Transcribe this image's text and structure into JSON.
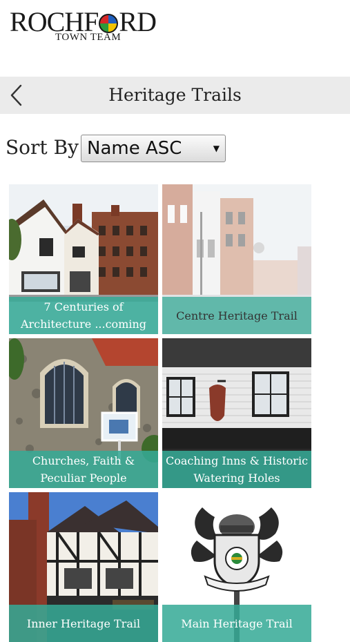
{
  "logo": {
    "main_pre": "R",
    "main_c": "OCHF",
    "main_post": "RD",
    "sub": "TOWN TEAM"
  },
  "header": {
    "title": "Heritage Trails",
    "back_icon": "chevron-left-icon"
  },
  "sort": {
    "label": "Sort By",
    "selected": "Name ASC",
    "arrow": "▼"
  },
  "colors": {
    "caption_bg": "#36aa96",
    "header_bg": "#ebebeb"
  },
  "trails": [
    {
      "title": "7 Centuries of Architecture ...coming"
    },
    {
      "title": "Centre Heritage Trail"
    },
    {
      "title": "Churches, Faith & Peculiar People"
    },
    {
      "title": "Coaching Inns & Historic Watering Holes"
    },
    {
      "title": "Inner Heritage Trail"
    },
    {
      "title": "Main Heritage Trail"
    }
  ]
}
